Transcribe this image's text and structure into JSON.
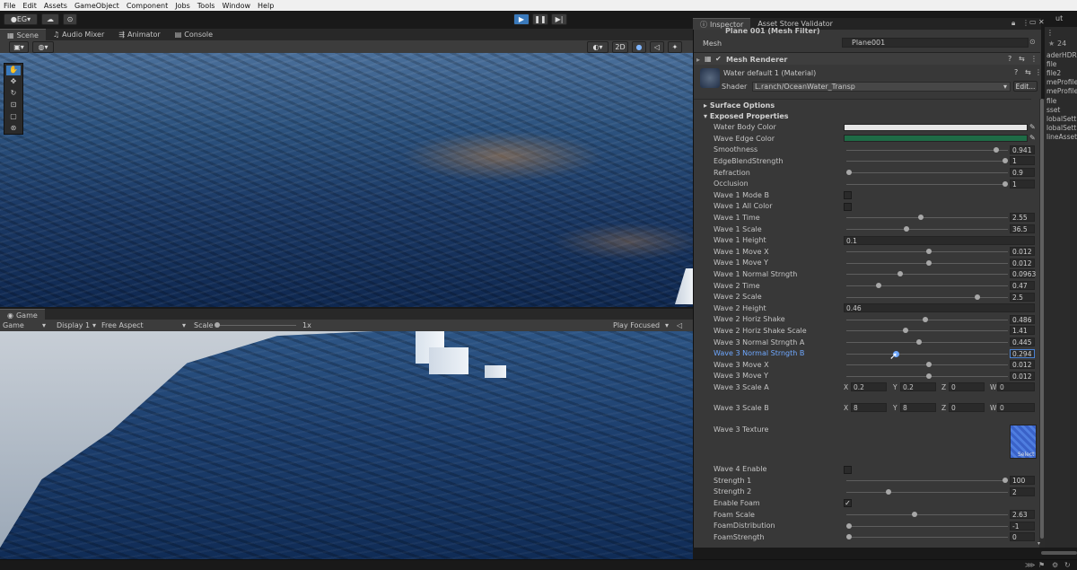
{
  "menu": [
    "File",
    "Edit",
    "Assets",
    "GameObject",
    "Component",
    "Jobs",
    "Tools",
    "Window",
    "Help"
  ],
  "toolbar": {
    "account": "EG",
    "play_icon": "play-icon",
    "pause_icon": "pause-icon",
    "step_icon": "step-icon",
    "layout": "ut"
  },
  "scene_tabs": [
    "Scene",
    "Audio Mixer",
    "Animator",
    "Console"
  ],
  "scene_toolbar": {
    "mode_2d": "2D"
  },
  "game": {
    "tab": "Game",
    "display_mode": "Game",
    "display": "Display 1",
    "aspect": "Free Aspect",
    "scale_label": "Scale",
    "scale_value": "1x",
    "play_focused": "Play Focused"
  },
  "inspector": {
    "tabs": [
      "Inspector",
      "Asset Store Validator"
    ],
    "mesh_filter_title": "Plane 001 (Mesh Filter)",
    "mesh_label": "Mesh",
    "mesh_value": "Plane001",
    "mesh_renderer": "Mesh Renderer",
    "material_name": "Water default 1 (Material)",
    "shader_label": "Shader",
    "shader_value": "L.ranch/OceanWater_Transp",
    "edit_label": "Edit...",
    "surface_options": "Surface Options",
    "exposed_properties": "Exposed Properties",
    "props": [
      {
        "label": "Water Body Color",
        "type": "color",
        "color": "#e6e6e6"
      },
      {
        "label": "Wave Edge Color",
        "type": "color",
        "color": "#1e6b46"
      },
      {
        "label": "Smoothness",
        "type": "slider",
        "value": "0.941",
        "pos": 0.94
      },
      {
        "label": "EdgeBlendStrength",
        "type": "slider",
        "value": "1",
        "pos": 1.0
      },
      {
        "label": "Refraction",
        "type": "slider",
        "value": "0.9",
        "pos": 0.0
      },
      {
        "label": "Occlusion",
        "type": "slider",
        "value": "1",
        "pos": 1.0
      },
      {
        "label": "Wave 1 Mode B",
        "type": "check",
        "checked": false
      },
      {
        "label": "Wave 1 All Color",
        "type": "check",
        "checked": false
      },
      {
        "label": "Wave 1 Time",
        "type": "slider",
        "value": "2.55",
        "pos": 0.46
      },
      {
        "label": "Wave 1 Scale",
        "type": "slider",
        "value": "36.5",
        "pos": 0.37
      },
      {
        "label": "Wave 1 Height",
        "type": "float",
        "value": "0.1"
      },
      {
        "label": "Wave 1 Move X",
        "type": "slider",
        "value": "0.012",
        "pos": 0.51
      },
      {
        "label": "Wave 1 Move Y",
        "type": "slider",
        "value": "0.012",
        "pos": 0.51
      },
      {
        "label": "Wave 1 Normal Strngth",
        "type": "slider",
        "value": "0.0963",
        "pos": 0.33
      },
      {
        "label": "Wave 2 Time",
        "type": "slider",
        "value": "0.47",
        "pos": 0.19
      },
      {
        "label": "Wave 2 Scale",
        "type": "slider",
        "value": "2.5",
        "pos": 0.82
      },
      {
        "label": "Wave 2 Height",
        "type": "float",
        "value": "0.46"
      },
      {
        "label": "Wave 2 Horiz Shake",
        "type": "slider",
        "value": "0.486",
        "pos": 0.49
      },
      {
        "label": "Wave 2 Horiz Shake Scale",
        "type": "slider",
        "value": "1.41",
        "pos": 0.36
      },
      {
        "label": "Wave 3 Normal Strngth A",
        "type": "slider",
        "value": "0.445",
        "pos": 0.45
      },
      {
        "label": "Wave 3 Normal Strngth B",
        "type": "slider",
        "value": "0.294",
        "pos": 0.3,
        "highlight": true
      },
      {
        "label": "Wave 3 Move X",
        "type": "slider",
        "value": "0.012",
        "pos": 0.51
      },
      {
        "label": "Wave 3 Move Y",
        "type": "slider",
        "value": "0.012",
        "pos": 0.51
      },
      {
        "label": "Wave 3 Scale A",
        "type": "vec4",
        "x": "0.2",
        "y": "0.2",
        "z": "0",
        "w": "0"
      }
    ],
    "scale_b": {
      "label": "Wave 3 Scale B",
      "x": "8",
      "y": "8",
      "z": "0",
      "w": "0"
    },
    "texture": {
      "label": "Wave 3 Texture",
      "select": "Select"
    },
    "props2": [
      {
        "label": "Wave 4 Enable",
        "type": "check",
        "checked": false
      },
      {
        "label": "Strength 1",
        "type": "slider",
        "value": "100",
        "pos": 1.0
      },
      {
        "label": "Strength 2",
        "type": "slider",
        "value": "2",
        "pos": 0.25
      },
      {
        "label": "Enable Foam",
        "type": "check",
        "checked": true
      },
      {
        "label": "Foam Scale",
        "type": "slider",
        "value": "2.63",
        "pos": 0.42
      },
      {
        "label": "FoamDistribution",
        "type": "slider",
        "value": "-1",
        "pos": 0.0
      },
      {
        "label": "FoamStrength",
        "type": "slider",
        "value": "0",
        "pos": 0.0
      }
    ],
    "axis_labels": {
      "x": "X",
      "y": "Y",
      "z": "Z",
      "w": "W"
    }
  },
  "project_side": [
    "aderHDR",
    "file",
    "file2",
    "meProfile",
    "meProfile",
    "file",
    "sset",
    "lobalSett",
    "lobalSett",
    "lineAsset"
  ],
  "side_count": "24"
}
